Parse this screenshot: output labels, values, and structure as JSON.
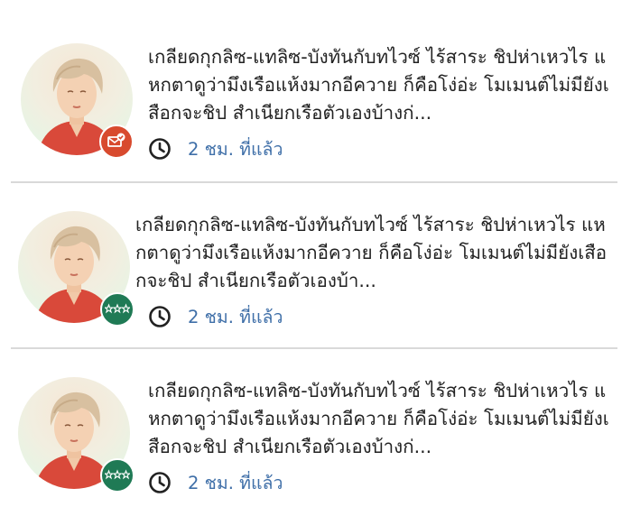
{
  "feed": {
    "items": [
      {
        "text": "เกลียดกุกลิซ-แทลิซ-บังทันกับทไวซ์ ไร้สาระ ชิปห่าเหวไร แหกตาดูว่ามึงเรือแห้งมากอีควาย ก็คือโง่อ่ะ โมเมนต์ไม่มียังเสือกจะชิป สำเนียกเรือตัวเองบ้างก่...",
        "time": "2 ชม. ที่แล้ว",
        "badge_icon": "mail-check-icon",
        "badge_color": "#d84a2e"
      },
      {
        "text": "เกลียดกุกลิซ-แทลิซ-บังทันกับทไวซ์ ไร้สาระ ชิปห่าเหวไร แหกตาดูว่ามึงเรือแห้งมากอีควาย ก็คือโง่อ่ะ โมเมนต์ไม่มียังเสือกจะชิป สำเนียกเรือตัวเองบ้า...",
        "time": "2 ชม. ที่แล้ว",
        "badge_icon": "three-stars-icon",
        "badge_color": "#1f7a55"
      },
      {
        "text": "เกลียดกุกลิซ-แทลิซ-บังทันกับทไวซ์ ไร้สาระ ชิปห่าเหวไร แหกตาดูว่ามึงเรือแห้งมากอีควาย ก็คือโง่อ่ะ โมเมนต์ไม่มียังเสือกจะชิป สำเนียกเรือตัวเองบ้างก่...",
        "time": "2 ชม. ที่แล้ว",
        "badge_icon": "three-stars-icon",
        "badge_color": "#1f7a55"
      }
    ],
    "colors": {
      "text": "#222222",
      "time": "#3f6fa8",
      "divider": "#d9d9d9"
    },
    "icons": {
      "time_icon": "clock-icon",
      "avatar": "avatar-portrait"
    }
  }
}
